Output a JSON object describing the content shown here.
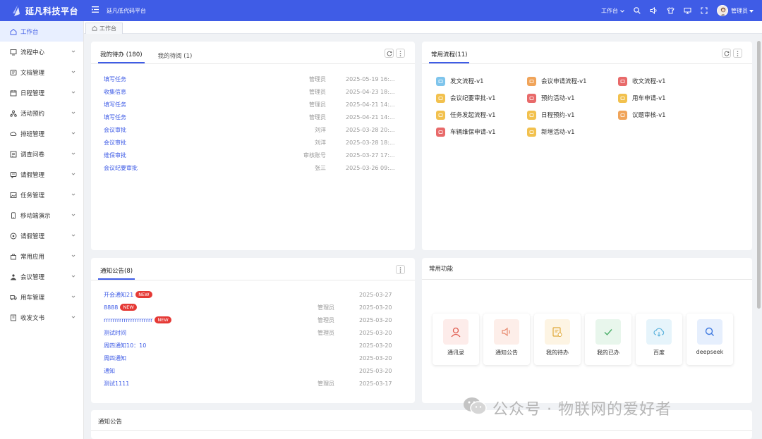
{
  "header": {
    "app_title": "延凡科技平台",
    "sub_title": "延凡低代码平台",
    "workspace_label": "工作台",
    "user_label": "管理员"
  },
  "sidebar": {
    "items": [
      {
        "label": "工作台",
        "icon": "home-icon"
      },
      {
        "label": "流程中心",
        "icon": "monitor-icon"
      },
      {
        "label": "文档管理",
        "icon": "doc-icon"
      },
      {
        "label": "日程管理",
        "icon": "calendar-icon"
      },
      {
        "label": "活动预约",
        "icon": "org-icon"
      },
      {
        "label": "排班管理",
        "icon": "cloud-icon"
      },
      {
        "label": "调查问卷",
        "icon": "survey-icon"
      },
      {
        "label": "请假管理",
        "icon": "message-icon"
      },
      {
        "label": "任务管理",
        "icon": "picture-icon"
      },
      {
        "label": "移动端演示",
        "icon": "phone-icon"
      },
      {
        "label": "请假管理",
        "icon": "circle-icon"
      },
      {
        "label": "常用应用",
        "icon": "bag-icon"
      },
      {
        "label": "会议管理",
        "icon": "meeting-icon"
      },
      {
        "label": "用车管理",
        "icon": "truck-icon"
      },
      {
        "label": "收发文书",
        "icon": "book-icon"
      }
    ]
  },
  "tabs": {
    "home": "工作台"
  },
  "todo": {
    "tab_pending": "我的待办 (180)",
    "tab_read": "我的待阅 (1)",
    "rows": [
      {
        "title": "填写任务",
        "user": "管理员",
        "time": "2025-05-19 16:..."
      },
      {
        "title": "收集信息",
        "user": "管理员",
        "time": "2025-04-23 18:..."
      },
      {
        "title": "填写任务",
        "user": "管理员",
        "time": "2025-04-21 14:..."
      },
      {
        "title": "填写任务",
        "user": "管理员",
        "time": "2025-04-21 14:..."
      },
      {
        "title": "会议审批",
        "user": "刘洋",
        "time": "2025-03-28 20:..."
      },
      {
        "title": "会议审批",
        "user": "刘洋",
        "time": "2025-03-28 18:..."
      },
      {
        "title": "维保审批",
        "user": "审核账号",
        "time": "2025-03-27 17:..."
      },
      {
        "title": "会议纪要审批",
        "user": "张三",
        "time": "2025-03-26 09:..."
      }
    ]
  },
  "flows": {
    "title": "常用流程(11)",
    "items": [
      {
        "label": "发文流程-v1",
        "color": "#7fc5ec"
      },
      {
        "label": "会议申请流程-v1",
        "color": "#f0a45a"
      },
      {
        "label": "收文流程-v1",
        "color": "#e86a6a"
      },
      {
        "label": "会议纪要审批-v1",
        "color": "#f2c14e"
      },
      {
        "label": "预约活动-v1",
        "color": "#e86a6a"
      },
      {
        "label": "用车申请-v1",
        "color": "#f2c14e"
      },
      {
        "label": "任务发起流程-v1",
        "color": "#f2c14e"
      },
      {
        "label": "日程预约-v1",
        "color": "#f2c14e"
      },
      {
        "label": "议题审核-v1",
        "color": "#f0a45a"
      },
      {
        "label": "车辆维保申请-v1",
        "color": "#e86a6a"
      },
      {
        "label": "新增活动-v1",
        "color": "#f2c14e"
      }
    ]
  },
  "notices": {
    "title": "通知公告(8)",
    "new_badge": "NEW",
    "rows": [
      {
        "title": "开会通知21",
        "user": "",
        "date": "2025-03-27",
        "is_new": true
      },
      {
        "title": "8888",
        "user": "管理员",
        "date": "2025-03-20",
        "is_new": true
      },
      {
        "title": "rrrrrrrrrrrrrrrrrrrrrr",
        "user": "管理员",
        "date": "2025-03-20",
        "is_new": true
      },
      {
        "title": "测试时间",
        "user": "管理员",
        "date": "2025-03-20",
        "is_new": false
      },
      {
        "title": "周四通知10：10",
        "user": "",
        "date": "2025-03-20",
        "is_new": false
      },
      {
        "title": "周四通知",
        "user": "",
        "date": "2025-03-20",
        "is_new": false
      },
      {
        "title": "通知",
        "user": "",
        "date": "2025-03-20",
        "is_new": false
      },
      {
        "title": "测试1111",
        "user": "管理员",
        "date": "2025-03-17",
        "is_new": false
      }
    ]
  },
  "functions": {
    "title": "常用功能",
    "apps": [
      {
        "label": "通讯录",
        "bg": "#fdecea",
        "fg": "#e05a4e"
      },
      {
        "label": "通知公告",
        "bg": "#fdeee9",
        "fg": "#e88a6f"
      },
      {
        "label": "我的待办",
        "bg": "#fdf4e3",
        "fg": "#e0a93a"
      },
      {
        "label": "我的已办",
        "bg": "#e8f6ec",
        "fg": "#4caf6a"
      },
      {
        "label": "百度",
        "bg": "#e6f4fb",
        "fg": "#5fb3dd"
      },
      {
        "label": "deepseek",
        "bg": "#e6effd",
        "fg": "#3f7ae0"
      }
    ]
  },
  "bottom": {
    "title": "通知公告"
  },
  "watermark": "公众号 · 物联网的爱好者"
}
